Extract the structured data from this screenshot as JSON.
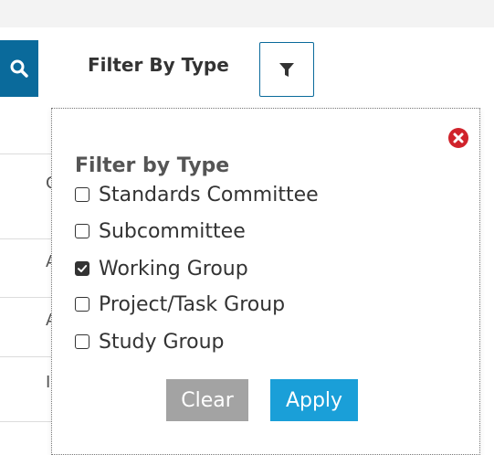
{
  "header": {
    "filter_label": "Filter By Type",
    "search_icon": "search-icon",
    "filter_icon": "funnel-icon"
  },
  "background_rows": [
    "C",
    "A",
    "A",
    "I"
  ],
  "popover": {
    "title": "Filter by Type",
    "close_icon": "close-circle-icon",
    "options": [
      {
        "label": "Standards Committee",
        "checked": false
      },
      {
        "label": "Subcommittee",
        "checked": false
      },
      {
        "label": "Working Group",
        "checked": true
      },
      {
        "label": "Project/Task Group",
        "checked": false
      },
      {
        "label": "Study Group",
        "checked": false
      }
    ],
    "clear_label": "Clear",
    "apply_label": "Apply"
  },
  "colors": {
    "primary": "#0a6a9b",
    "apply": "#1a9fd8",
    "clear": "#a3a3a3",
    "close": "#d0232b"
  }
}
